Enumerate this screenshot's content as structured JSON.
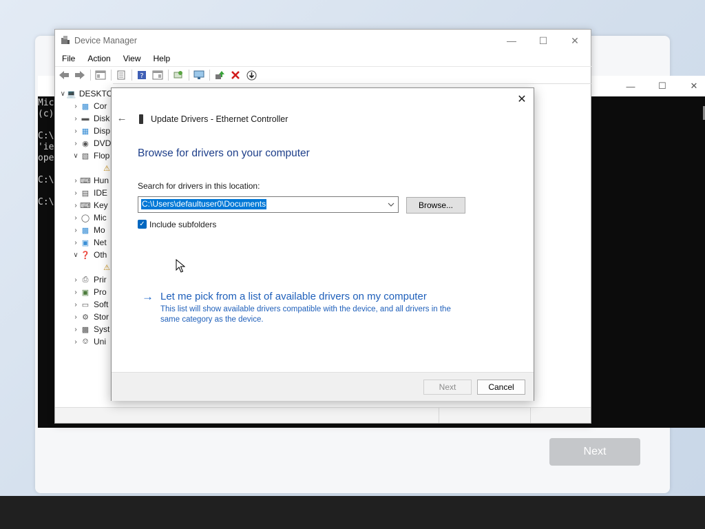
{
  "setup": {
    "next_label": "Next"
  },
  "cmd": {
    "lines": [
      "Mic",
      "(c)",
      "",
      "C:\\",
      "'ie",
      "ope",
      "",
      "C:\\",
      "",
      "C:\\"
    ],
    "maximize_icon": "maximize-icon",
    "close_icon": "close-icon"
  },
  "device_manager": {
    "title": "Device Manager",
    "menu": [
      "File",
      "Action",
      "View",
      "Help"
    ],
    "tree": [
      {
        "label": "DESKTO",
        "expanded": true,
        "icon": "computer-icon"
      },
      {
        "label": "Cor",
        "icon": "monitor-icon"
      },
      {
        "label": "Disk",
        "icon": "disk-drive-icon"
      },
      {
        "label": "Disp",
        "icon": "display-adapter-icon"
      },
      {
        "label": "DVD",
        "icon": "dvd-icon"
      },
      {
        "label": "Flop",
        "expanded": true,
        "icon": "floppy-icon"
      },
      {
        "label": "",
        "icon": "warning-device-icon"
      },
      {
        "label": "Hun",
        "icon": "hid-icon"
      },
      {
        "label": "IDE",
        "icon": "ide-icon"
      },
      {
        "label": "Key",
        "icon": "keyboard-icon"
      },
      {
        "label": "Mic",
        "icon": "mouse-icon"
      },
      {
        "label": "Mo",
        "icon": "monitor-icon"
      },
      {
        "label": "Net",
        "icon": "network-icon"
      },
      {
        "label": "Oth",
        "expanded": true,
        "icon": "other-devices-icon"
      },
      {
        "label": "",
        "icon": "warning-device-icon"
      },
      {
        "label": "Prir",
        "icon": "printer-icon"
      },
      {
        "label": "Pro",
        "icon": "processor-icon"
      },
      {
        "label": "Soft",
        "icon": "software-device-icon"
      },
      {
        "label": "Stor",
        "icon": "storage-icon"
      },
      {
        "label": "Syst",
        "icon": "system-device-icon"
      },
      {
        "label": "Uni",
        "icon": "usb-icon"
      }
    ]
  },
  "dialog": {
    "title": "Update Drivers - Ethernet Controller",
    "heading": "Browse for drivers on your computer",
    "search_label": "Search for drivers in this location:",
    "path_value": "C:\\Users\\defaultuser0\\Documents",
    "browse_label": "Browse...",
    "include_subfolders_label": "Include subfolders",
    "include_subfolders_checked": true,
    "pick_link": "Let me pick from a list of available drivers on my computer",
    "pick_desc": "This list will show available drivers compatible with the device, and all drivers in the same category as the device.",
    "next_label": "Next",
    "cancel_label": "Cancel"
  },
  "colors": {
    "accent": "#0067c0",
    "link": "#1e5fba",
    "heading": "#1e3f8a",
    "selection": "#0078d7"
  }
}
